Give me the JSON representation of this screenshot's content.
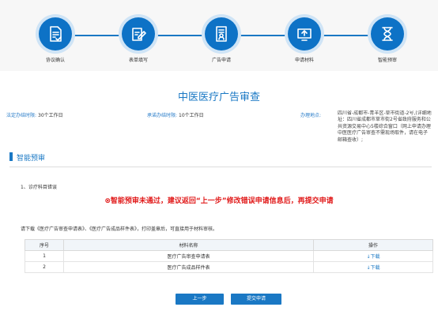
{
  "steps": [
    {
      "label": "协议确认",
      "icon": "document-check-icon"
    },
    {
      "label": "表单填写",
      "icon": "form-edit-icon"
    },
    {
      "label": "广告申请",
      "icon": "document-person-icon"
    },
    {
      "label": "申请材料",
      "icon": "upload-icon"
    },
    {
      "label": "智能预审",
      "icon": "hourglass-icon"
    }
  ],
  "page_title": "中医医疗广告审查",
  "info": {
    "legal_time_label": "法定办结时限:",
    "legal_time_value": "30个工作日",
    "promise_time_label": "承诺办结时限:",
    "promise_time_value": "10个工作日",
    "address_label": "办理地点:",
    "address_lines": [
      "四川省-成都市-青羊区-草市街道-2号,(详细地",
      "址：四川省成都市草市街2号省政府服务和公",
      "共资源交易中心5楼综合窗口（网上申请办理",
      "中医医疗广告审查不需现场取件，请在电子",
      "邮箱查收）;"
    ]
  },
  "section_title": "智能预审",
  "diagnosis": "1、诊疗科目错误",
  "warning": "⊗智能预审未通过，建议返回“上一步”修改错误申请信息后，再提交申请",
  "download_note": "请下载《医疗广告审查申请表》、《医疗广告成品样件表》，打印盖章后，可直接用于材料审核。",
  "table": {
    "headers": [
      "序号",
      "材料名称",
      "操作"
    ],
    "rows": [
      {
        "no": "1",
        "name": "医疗广告审查申请表",
        "action": "↓下载"
      },
      {
        "no": "2",
        "name": "医疗广告成品样件表",
        "action": "↓下载"
      }
    ]
  },
  "buttons": {
    "prev": "上一步",
    "submit": "提交申请"
  },
  "colors": {
    "primary": "#1a78c4",
    "warning": "#e11b1b"
  }
}
